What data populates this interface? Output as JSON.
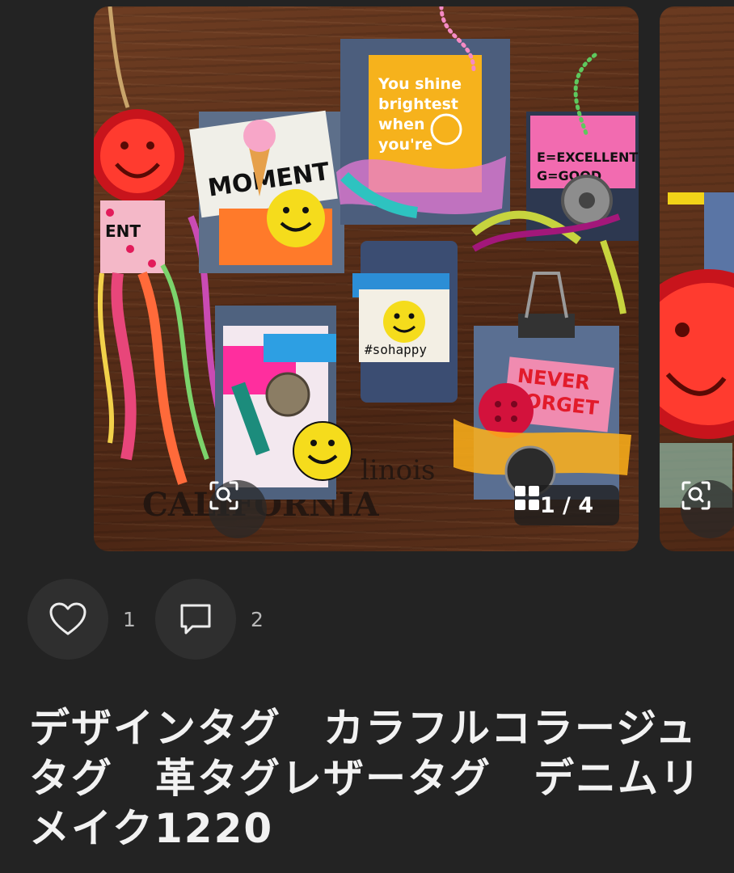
{
  "carousel": {
    "counter_label": "1 / 4",
    "icons": {
      "zoom": "visual-search-icon",
      "gallery": "grid-icon"
    }
  },
  "photo_text": {
    "tag1_line1": "You shine",
    "tag1_line2": "brightest",
    "tag1_line3": "when",
    "tag1_line4": "you're",
    "tag_sohappy": "#sohappy",
    "tag_moment": "MOMENT",
    "tag_never": "NEVER",
    "tag_forget": "FORGET",
    "board_text": "CALIFORNIA",
    "board_text2": "linois"
  },
  "actions": {
    "like_count": "1",
    "comment_count": "2"
  },
  "title": "デザインタグ　カラフルコラージュタグ　革タグレザータグ　デニムリメイク1220",
  "colors": {
    "background": "#232323",
    "button_bg": "#2f2f2f",
    "text": "#f2f2f2",
    "count_text": "#b8b8b8"
  }
}
